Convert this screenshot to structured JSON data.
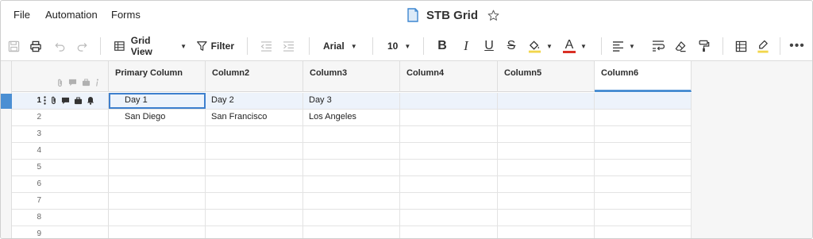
{
  "menu": {
    "items": [
      "File",
      "Automation",
      "Forms"
    ]
  },
  "document": {
    "title": "STB Grid",
    "icon": "sheet-icon",
    "favorite_icon": "star-icon"
  },
  "toolbar": {
    "view_label": "Grid View",
    "filter_label": "Filter",
    "font_family": "Arial",
    "font_size": "10",
    "bold_glyph": "B",
    "italic_glyph": "I",
    "underline_glyph": "U",
    "strike_glyph": "S",
    "text_color_glyph": "A",
    "more_glyph": "•••",
    "colors": {
      "fill_swatch": "#f2d64b",
      "text_swatch": "#d93025"
    }
  },
  "grid": {
    "columns": [
      "Primary Column",
      "Column2",
      "Column3",
      "Column4",
      "Column5",
      "Column6"
    ],
    "selected_column": "Column6",
    "rows": [
      {
        "number": "1",
        "cells": [
          "Day 1",
          "Day 2",
          "Day 3",
          "",
          "",
          ""
        ]
      },
      {
        "number": "2",
        "cells": [
          "San Diego",
          "San Francisco",
          "Los Angeles",
          "",
          "",
          ""
        ]
      },
      {
        "number": "3",
        "cells": [
          "",
          "",
          "",
          "",
          "",
          ""
        ]
      },
      {
        "number": "4",
        "cells": [
          "",
          "",
          "",
          "",
          "",
          ""
        ]
      },
      {
        "number": "5",
        "cells": [
          "",
          "",
          "",
          "",
          "",
          ""
        ]
      },
      {
        "number": "6",
        "cells": [
          "",
          "",
          "",
          "",
          "",
          ""
        ]
      },
      {
        "number": "7",
        "cells": [
          "",
          "",
          "",
          "",
          "",
          ""
        ]
      },
      {
        "number": "8",
        "cells": [
          "",
          "",
          "",
          "",
          "",
          ""
        ]
      },
      {
        "number": "9",
        "cells": [
          "",
          "",
          "",
          "",
          "",
          ""
        ]
      }
    ],
    "accent_color": "#4b8fd3"
  }
}
